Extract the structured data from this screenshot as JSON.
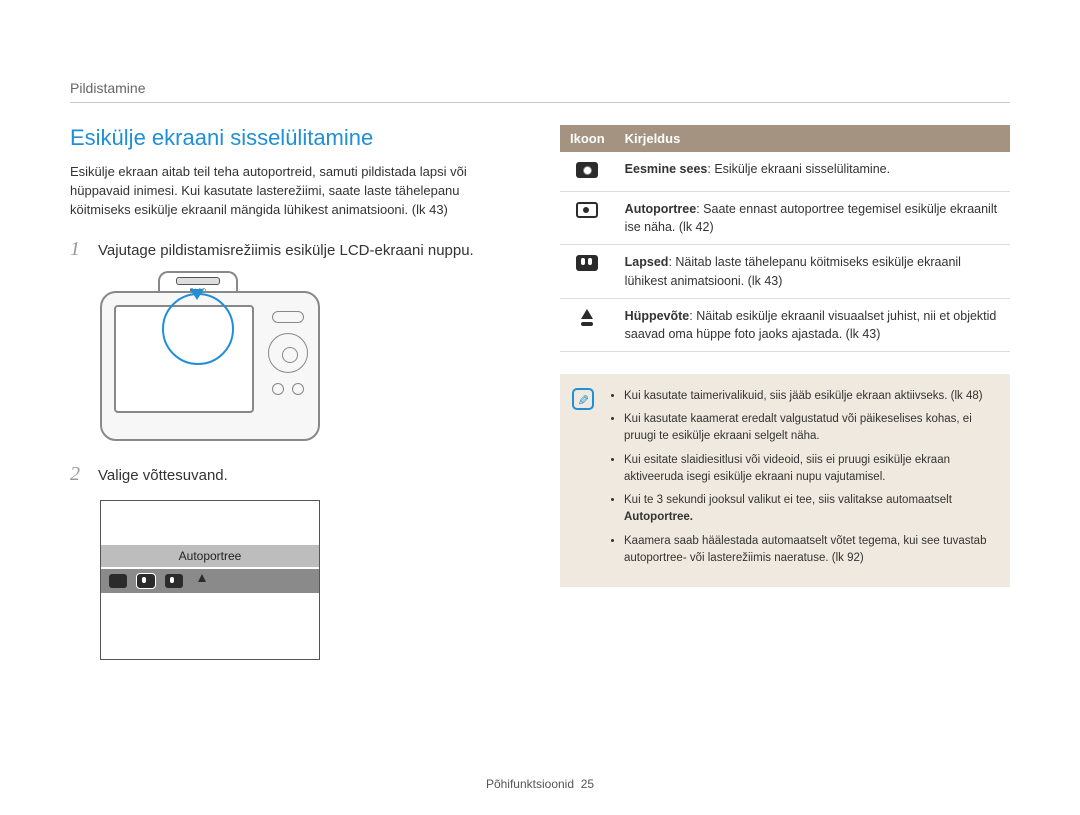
{
  "breadcrumb": "Pildistamine",
  "title": "Esikülje ekraani sisselülitamine",
  "intro": "Esikülje ekraan aitab teil teha autoportreid, samuti pildistada lapsi või hüppavaid inimesi. Kui kasutate lasterežiimi, saate laste tähelepanu köitmiseks esikülje ekraanil mängida lühikest animatsiooni. (lk 43)",
  "steps": [
    {
      "num": "1",
      "text": "Vajutage pildistamisrežiimis esikülje LCD-ekraani nuppu."
    },
    {
      "num": "2",
      "text": "Valige võttesuvand."
    }
  ],
  "camera_label": "F.LCD",
  "sel_label": "Autoportree",
  "table": {
    "head_icon": "Ikoon",
    "head_desc": "Kirjeldus",
    "rows": [
      {
        "icon": "front-in-icon",
        "lead": "Eesmine sees",
        "desc": ": Esikülje ekraani sisselülitamine."
      },
      {
        "icon": "self-portrait-icon",
        "lead": "Autoportree",
        "desc": ": Saate ennast autoportree tegemisel esikülje ekraanilt ise näha. (lk 42)"
      },
      {
        "icon": "children-icon",
        "lead": "Lapsed",
        "desc": ": Näitab laste tähelepanu köitmiseks esikülje ekraanil lühikest animatsiooni. (lk 43)"
      },
      {
        "icon": "jump-shot-icon",
        "lead": "Hüppevõte",
        "desc": ": Näitab esikülje ekraanil visuaalset juhist, nii et objektid saavad oma hüppe foto jaoks ajastada. (lk 43)"
      }
    ]
  },
  "notes": [
    "Kui kasutate taimerivalikuid, siis jääb esikülje ekraan aktiivseks. (lk 48)",
    "Kui kasutate kaamerat eredalt valgustatud või päikeselises kohas, ei pruugi te esikülje ekraani selgelt näha.",
    "Kui esitate slaidiesitlusi või videoid, siis ei pruugi esikülje ekraan aktiveeruda isegi esikülje ekraani nupu vajutamisel.",
    "Kui te 3 sekundi jooksul valikut ei tee, siis valitakse automaatselt ",
    "Kaamera saab häälestada automaatselt võtet tegema, kui see tuvastab autoportree- või lasterežiimis naeratuse. (lk 92)"
  ],
  "note_bold_suffix": "Autoportree.",
  "footer_label": "Põhifunktsioonid",
  "footer_page": "25"
}
